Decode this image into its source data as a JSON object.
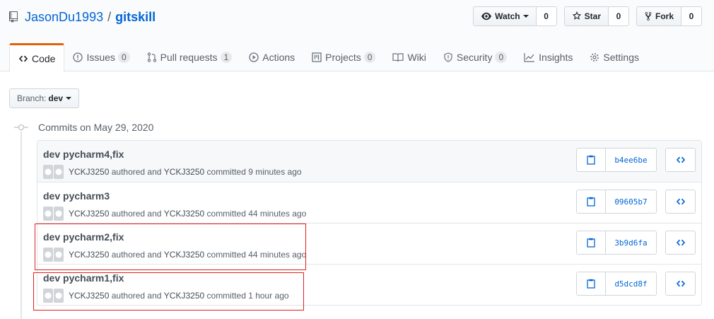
{
  "repo": {
    "owner": "JasonDu1993",
    "separator": "/",
    "name": "gitskill"
  },
  "actions": [
    {
      "label": "Watch",
      "count": "0",
      "icon": "eye-icon",
      "dropdown": true
    },
    {
      "label": "Star",
      "count": "0",
      "icon": "star-icon",
      "dropdown": false
    },
    {
      "label": "Fork",
      "count": "0",
      "icon": "fork-icon",
      "dropdown": false
    }
  ],
  "tabs": [
    {
      "label": "Code",
      "icon": "code-icon",
      "counter": null,
      "selected": true
    },
    {
      "label": "Issues",
      "icon": "issue-icon",
      "counter": "0"
    },
    {
      "label": "Pull requests",
      "icon": "pull-request-icon",
      "counter": "1"
    },
    {
      "label": "Actions",
      "icon": "play-icon",
      "counter": null
    },
    {
      "label": "Projects",
      "icon": "project-icon",
      "counter": "0"
    },
    {
      "label": "Wiki",
      "icon": "book-icon",
      "counter": null
    },
    {
      "label": "Security",
      "icon": "shield-icon",
      "counter": "0"
    },
    {
      "label": "Insights",
      "icon": "graph-icon",
      "counter": null
    },
    {
      "label": "Settings",
      "icon": "gear-icon",
      "counter": null
    }
  ],
  "branch": {
    "label": "Branch:",
    "value": "dev"
  },
  "commit_group": {
    "title": "Commits on May 29, 2020"
  },
  "commits": [
    {
      "title": "dev pycharm4,fix",
      "author": "YCKJ3250",
      "authored_text": "authored and",
      "committer": "YCKJ3250",
      "committed_text": "committed 9 minutes ago",
      "sha": "b4ee6be"
    },
    {
      "title": "dev pycharm3",
      "author": "YCKJ3250",
      "authored_text": "authored and",
      "committer": "YCKJ3250",
      "committed_text": "committed 44 minutes ago",
      "sha": "09605b7"
    },
    {
      "title": "dev pycharm2,fix",
      "author": "YCKJ3250",
      "authored_text": "authored and",
      "committer": "YCKJ3250",
      "committed_text": "committed 44 minutes ago",
      "sha": "3b9d6fa"
    },
    {
      "title": "dev pycharm1,fix",
      "author": "YCKJ3250",
      "authored_text": "authored and",
      "committer": "YCKJ3250",
      "committed_text": "committed 1 hour ago",
      "sha": "d5dcd8f"
    }
  ],
  "colors": {
    "link": "#0366d6",
    "selected_tab_accent": "#e36209",
    "highlight": "#e02020"
  }
}
